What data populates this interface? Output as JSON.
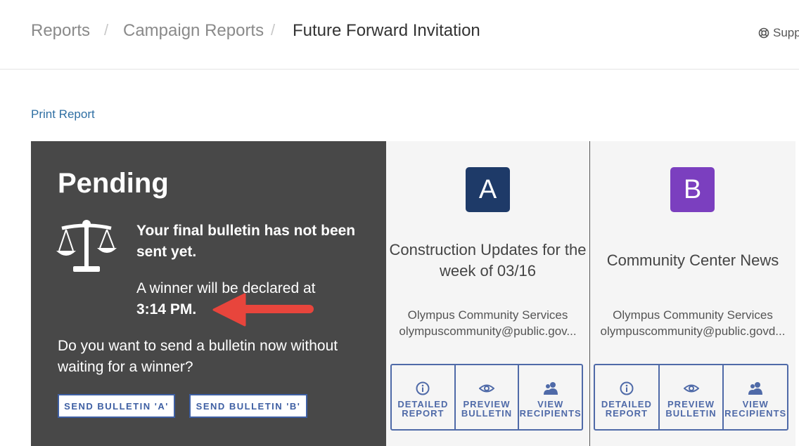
{
  "breadcrumb": {
    "items": [
      "Reports",
      "Campaign Reports"
    ],
    "current": "Future Forward Invitation",
    "separator": "/"
  },
  "support": {
    "label": "Supp",
    "icon": "lifebuoy-icon"
  },
  "print_report": "Print Report",
  "pending": {
    "title": "Pending",
    "icon": "scale-icon",
    "not_sent": "Your final bulletin has not been sent yet.",
    "winner_text": "A winner will be declared at",
    "winner_time": "3:14 PM.",
    "question": "Do you want to send a bulletin now without waiting for a winner?",
    "send_a": "SEND BULLETIN 'A'",
    "send_b": "SEND BULLETIN 'B'",
    "arrow_color": "#e8453c"
  },
  "variants": [
    {
      "badge": "A",
      "badge_color": "#1e3a68",
      "title": "Construction Updates for the week of 03/16",
      "sender_name": "Olympus Community Services",
      "sender_email": "olympuscommunity@public.gov...",
      "actions": [
        {
          "line1": "DETAILED",
          "line2": "REPORT",
          "icon": "info-icon"
        },
        {
          "line1": "PREVIEW",
          "line2": "BULLETIN",
          "icon": "eye-icon"
        },
        {
          "line1": "VIEW",
          "line2": "RECIPIENTS",
          "icon": "users-icon"
        }
      ]
    },
    {
      "badge": "B",
      "badge_color": "#7b3fbf",
      "title": "Community Center News",
      "sender_name": "Olympus Community Services",
      "sender_email": "olympuscommunity@public.govd...",
      "actions": [
        {
          "line1": "DETAILED",
          "line2": "REPORT",
          "icon": "info-icon"
        },
        {
          "line1": "PREVIEW",
          "line2": "BULLETIN",
          "icon": "eye-icon"
        },
        {
          "line1": "VIEW",
          "line2": "RECIPIENTS",
          "icon": "users-icon"
        }
      ]
    }
  ]
}
